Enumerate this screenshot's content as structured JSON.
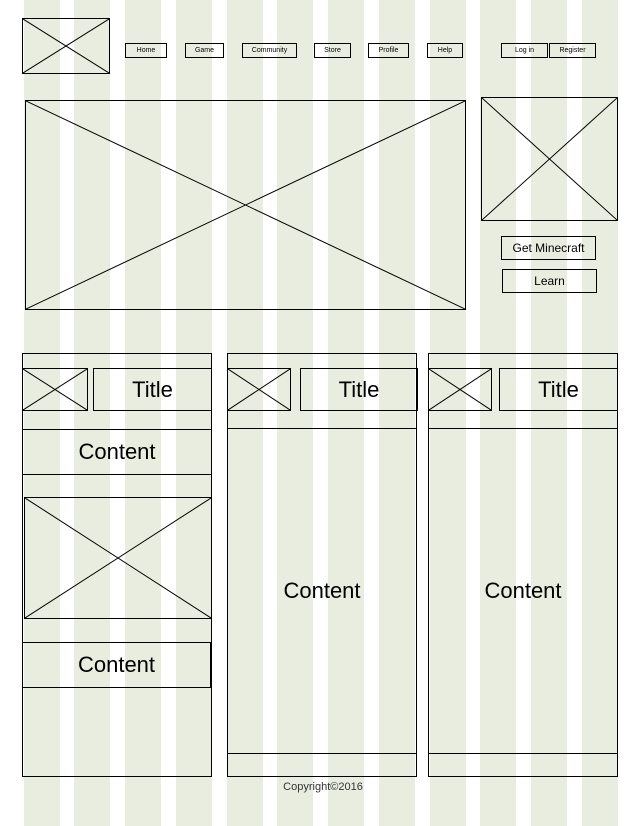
{
  "nav": {
    "items": [
      "Home",
      "Game",
      "Community",
      "Store",
      "Profile",
      "Help"
    ],
    "login_label": "Log in",
    "register_label": "Register"
  },
  "hero": {
    "cta_primary": "Get Minecraft",
    "cta_secondary": "Learn"
  },
  "columns": [
    {
      "title": "Title",
      "content_1": "Content",
      "content_2": "Content"
    },
    {
      "title": "Title",
      "content": "Content"
    },
    {
      "title": "Title",
      "content": "Content"
    }
  ],
  "footer": {
    "copyright": "Copyright©2016"
  }
}
